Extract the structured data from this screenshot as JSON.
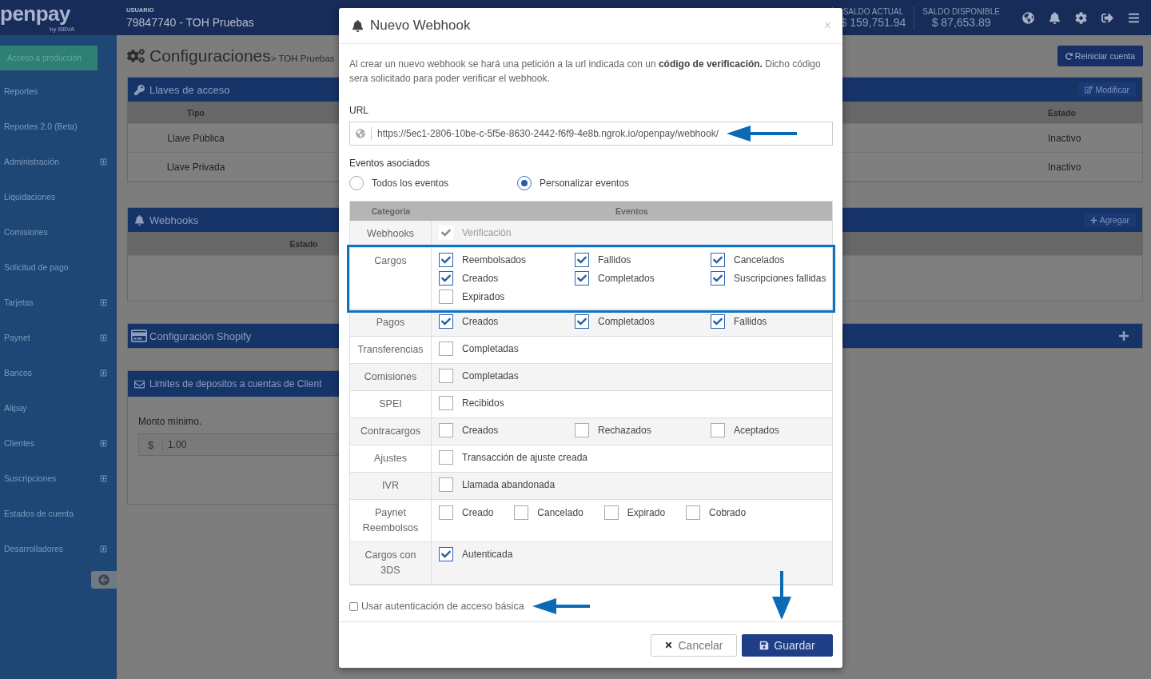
{
  "header": {
    "logo": "penpay",
    "logo_sub": "by BBVA",
    "user_label": "USUARIO",
    "user": "79847740 - TOH Pruebas",
    "balances": [
      {
        "label": "SALDO ACTUAL",
        "value": "$ 159,751.94"
      },
      {
        "label": "SALDO DISPONIBLE",
        "value": "$ 87,653.89"
      }
    ]
  },
  "sidebar": {
    "production_button": "Acceso a producción",
    "items": [
      {
        "label": "Reportes",
        "expandable": false
      },
      {
        "label": "Reportes 2.0 (Beta)",
        "expandable": false
      },
      {
        "label": "Administración",
        "expandable": true
      },
      {
        "label": "Liquidaciones",
        "expandable": false
      },
      {
        "label": "Comisiones",
        "expandable": false
      },
      {
        "label": "Solicitud de pago",
        "expandable": false
      },
      {
        "label": "Tarjetas",
        "expandable": true
      },
      {
        "label": "Paynet",
        "expandable": true
      },
      {
        "label": "Bancos",
        "expandable": true
      },
      {
        "label": "Alipay",
        "expandable": false
      },
      {
        "label": "Clientes",
        "expandable": true
      },
      {
        "label": "Suscripciones",
        "expandable": true
      },
      {
        "label": "Estados de cuenta",
        "expandable": false
      },
      {
        "label": "Desarrolladores",
        "expandable": true
      }
    ]
  },
  "page": {
    "title": "Configuraciones",
    "breadcrumb": "> TOH Pruebas",
    "reset_button": "Reiniciar cuenta",
    "access_keys": {
      "title": "Llaves de acceso",
      "edit_button": "Modificar",
      "columns": [
        "Tipo",
        "Estado"
      ],
      "rows": [
        [
          "Llave Pública",
          "Inactivo"
        ],
        [
          "Llave Privada",
          "Inactivo"
        ]
      ]
    },
    "webhooks": {
      "title": "Webhooks",
      "add_button": "Agregar",
      "column": "Estado"
    },
    "shopify": {
      "title": "Configuración Shopify"
    },
    "limits": {
      "title": "Limites de depositos a cuentas de Client",
      "min_label": "Monto mínimo.",
      "currency": "$",
      "min_value": "1.00"
    }
  },
  "modal": {
    "title": "Nuevo Webhook",
    "close": "×",
    "description": "Al crear un nuevo webhook se hará una petición a la url indicada con un **código de verificación.** Dicho código sera solicitado para poder verificar el webhook.",
    "url_label": "URL",
    "url_value": "https://5ec1-2806-10be-c-5f5e-8630-2442-f6f9-4e8b.ngrok.io/openpay/webhook/",
    "events_label": "Eventos asociados",
    "modes": [
      {
        "label": "Todos los eventos",
        "selected": false
      },
      {
        "label": "Personalizar eventos",
        "selected": true
      }
    ],
    "columns": [
      "Categoria",
      "Eventos"
    ],
    "categories": [
      {
        "name": "Webhooks",
        "locked": true,
        "highlighted": false,
        "kind": "grid",
        "events": [
          {
            "label": "Verificación",
            "checked": true
          }
        ]
      },
      {
        "name": "Cargos",
        "locked": false,
        "highlighted": true,
        "kind": "grid",
        "events": [
          {
            "label": "Reembolsados",
            "checked": true
          },
          {
            "label": "Fallidos",
            "checked": true
          },
          {
            "label": "Cancelados",
            "checked": true
          },
          {
            "label": "Creados",
            "checked": true
          },
          {
            "label": "Completados",
            "checked": true
          },
          {
            "label": "Suscripciones fallidas",
            "checked": true
          },
          {
            "label": "Expirados",
            "checked": false
          }
        ]
      },
      {
        "name": "Pagos",
        "locked": false,
        "highlighted": false,
        "kind": "grid",
        "events": [
          {
            "label": "Creados",
            "checked": true
          },
          {
            "label": "Completados",
            "checked": true
          },
          {
            "label": "Fallidos",
            "checked": true
          }
        ]
      },
      {
        "name": "Transferencias",
        "locked": false,
        "highlighted": false,
        "kind": "grid",
        "events": [
          {
            "label": "Completadas",
            "checked": false
          }
        ]
      },
      {
        "name": "Comisiones",
        "locked": false,
        "highlighted": false,
        "kind": "grid",
        "events": [
          {
            "label": "Completadas",
            "checked": false
          }
        ]
      },
      {
        "name": "SPEI",
        "locked": false,
        "highlighted": false,
        "kind": "grid",
        "events": [
          {
            "label": "Recibidos",
            "checked": false
          }
        ]
      },
      {
        "name": "Contracargos",
        "locked": false,
        "highlighted": false,
        "kind": "grid",
        "events": [
          {
            "label": "Creados",
            "checked": false
          },
          {
            "label": "Rechazados",
            "checked": false
          },
          {
            "label": "Aceptados",
            "checked": false
          }
        ]
      },
      {
        "name": "Ajustes",
        "locked": false,
        "highlighted": false,
        "kind": "grid",
        "events": [
          {
            "label": "Transacción de ajuste creada",
            "checked": false
          }
        ]
      },
      {
        "name": "IVR",
        "locked": false,
        "highlighted": false,
        "kind": "grid",
        "events": [
          {
            "label": "Llamada abandonada",
            "checked": false
          }
        ]
      },
      {
        "name": "Paynet Reembolsos",
        "locked": false,
        "highlighted": false,
        "kind": "inline",
        "events": [
          {
            "label": "Creado",
            "checked": false
          },
          {
            "label": "Cancelado",
            "checked": false
          },
          {
            "label": "Expirado",
            "checked": false
          },
          {
            "label": "Cobrado",
            "checked": false
          }
        ]
      },
      {
        "name": "Cargos con 3DS",
        "locked": false,
        "highlighted": false,
        "kind": "grid",
        "events": [
          {
            "label": "Autenticada",
            "checked": true
          }
        ]
      }
    ],
    "basic_auth": {
      "label": "Usar autenticación de acceso básica",
      "checked": false
    },
    "cancel_button": "Cancelar",
    "save_button": "Guardar"
  }
}
